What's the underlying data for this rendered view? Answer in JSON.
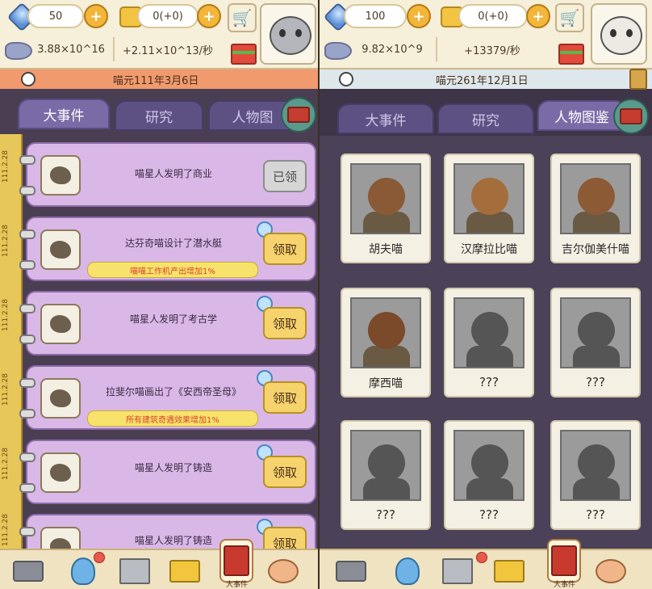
{
  "left": {
    "resources": {
      "gems": "50",
      "tickets": "0(+0)",
      "fish_total": "3.88×10^16",
      "fish_rate": "+2.11×10^13/秒"
    },
    "date": "喵元111年3月6日",
    "tabs": [
      "大事件",
      "研究",
      "人物图"
    ],
    "active_tab": "大事件",
    "timeline_labels": [
      "111.2.28",
      "111.2.28",
      "111.2.28",
      "111.2.28",
      "111.2.28",
      "111.2.28"
    ],
    "events": [
      {
        "title": "喵星人发明了商业",
        "bonus": "",
        "button": "已领",
        "claimed": true
      },
      {
        "title": "达芬奇喵设计了潜水艇",
        "bonus": "喵喵工作机产出增加1%",
        "button": "领取",
        "claimed": false
      },
      {
        "title": "喵星人发明了考古学",
        "bonus": "",
        "button": "领取",
        "claimed": false
      },
      {
        "title": "拉斐尔喵画出了《安西帝圣母》",
        "bonus": "所有建筑奇遇效果增加1%",
        "button": "领取",
        "claimed": false
      },
      {
        "title": "喵星人发明了铸造",
        "bonus": "",
        "button": "领取",
        "claimed": false
      },
      {
        "title": "喵星人发明了铸造",
        "bonus": "",
        "button": "领取",
        "claimed": false
      }
    ],
    "bottom_nav": {
      "book_label": "大事件"
    }
  },
  "right": {
    "resources": {
      "gems": "100",
      "tickets": "0(+0)",
      "fish_total": "9.82×10^9",
      "fish_rate": "+13379/秒"
    },
    "date": "喵元261年12月1日",
    "tabs": [
      "大事件",
      "研究",
      "人物图鉴"
    ],
    "active_tab": "人物图鉴",
    "characters": [
      {
        "name": "胡夫喵",
        "unlocked": true,
        "skin": "#8a5a36"
      },
      {
        "name": "汉摩拉比喵",
        "unlocked": true,
        "skin": "#a56c3c"
      },
      {
        "name": "吉尔伽美什喵",
        "unlocked": true,
        "skin": "#8c5a34"
      },
      {
        "name": "摩西喵",
        "unlocked": true,
        "skin": "#7a4a2a"
      },
      {
        "name": "???",
        "unlocked": false,
        "skin": "#555555"
      },
      {
        "name": "???",
        "unlocked": false,
        "skin": "#555555"
      },
      {
        "name": "???",
        "unlocked": false,
        "skin": "#555555"
      },
      {
        "name": "???",
        "unlocked": false,
        "skin": "#555555"
      },
      {
        "name": "???",
        "unlocked": false,
        "skin": "#555555"
      }
    ],
    "bottom_nav": {
      "book_label": "大事件"
    }
  },
  "colors": {
    "card_bg": "#d9b8e8",
    "tab_active": "#7a6aa6",
    "claim_button": "#f6d36d",
    "bonus_text": "#d9422f"
  }
}
